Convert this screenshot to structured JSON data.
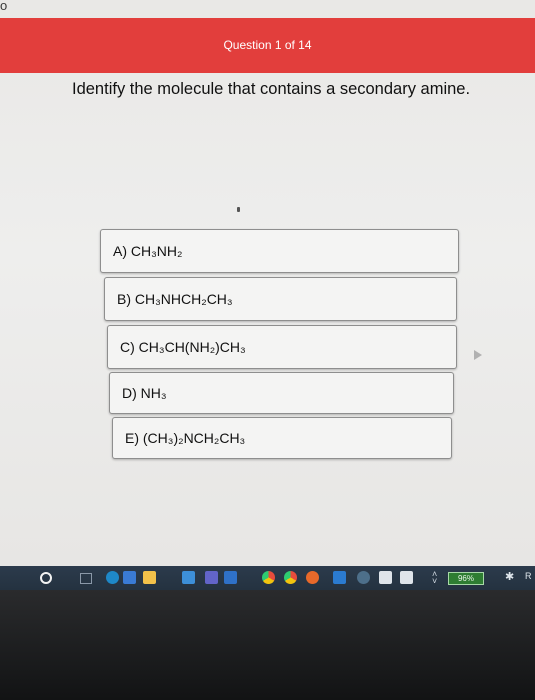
{
  "corner_text": "o",
  "header": {
    "title": "Question 1 of 14"
  },
  "question": {
    "text": "Identify the molecule that contains a secondary amine."
  },
  "options": [
    {
      "label": "A) CH₃NH₂"
    },
    {
      "label": "B) CH₃NHCH₂CH₃"
    },
    {
      "label": "C) CH₃CH(NH₂)CH₃"
    },
    {
      "label": "D) NH₃"
    },
    {
      "label": "E) (CH₃)₂NCH₂CH₃"
    }
  ],
  "taskbar": {
    "battery": "96%",
    "right_text": "R",
    "icons": [
      "windows-start-icon",
      "task-view-icon",
      "edge-icon",
      "store-icon",
      "file-explorer-icon",
      "mail-icon",
      "teams-icon",
      "outlook-icon",
      "chrome-icon",
      "chrome-profile-icon",
      "firefox-icon",
      "photos-icon",
      "settings-icon",
      "pen-icon",
      "sticky-icon",
      "chevron-icon",
      "wifi-icon"
    ]
  }
}
